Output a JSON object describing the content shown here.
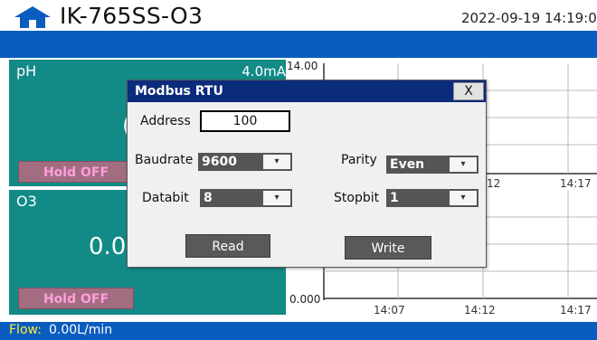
{
  "header": {
    "device_name": "IK-765SS-O3",
    "datetime": "2022-09-19 14:19:07"
  },
  "icons": {
    "home": "home-icon"
  },
  "colors": {
    "teal_panel": "#128a86",
    "blue_bar": "#0b5cbf",
    "titlebar": "#0b2b7c",
    "hold_button": "#a26d80",
    "hold_text": "#ff9edb",
    "flow_label": "#ffeb3b"
  },
  "panels": {
    "ph": {
      "title": "pH",
      "current": "4.0mA",
      "value": "(",
      "hold_label": "Hold OFF"
    },
    "o3": {
      "title": "O3",
      "value": "0.0",
      "hold_label": "Hold OFF"
    }
  },
  "chart": {
    "y_max": "14.00",
    "y_min": "0.000",
    "upper_x_ticks": [
      "12",
      "14:17"
    ],
    "lower_x_ticks": [
      "14:07",
      "14:12",
      "14:17"
    ]
  },
  "footer": {
    "flow_label": "Flow:",
    "flow_value": "0.00L/min"
  },
  "modal": {
    "title": "Modbus RTU",
    "close_label": "X",
    "address_label": "Address",
    "address_value": "100",
    "baudrate_label": "Baudrate",
    "baudrate_value": "9600",
    "parity_label": "Parity",
    "parity_value": "Even",
    "databit_label": "Databit",
    "databit_value": "8",
    "stopbit_label": "Stopbit",
    "stopbit_value": "1",
    "dropdown_arrow": "▾",
    "read_label": "Read",
    "write_label": "Write"
  }
}
